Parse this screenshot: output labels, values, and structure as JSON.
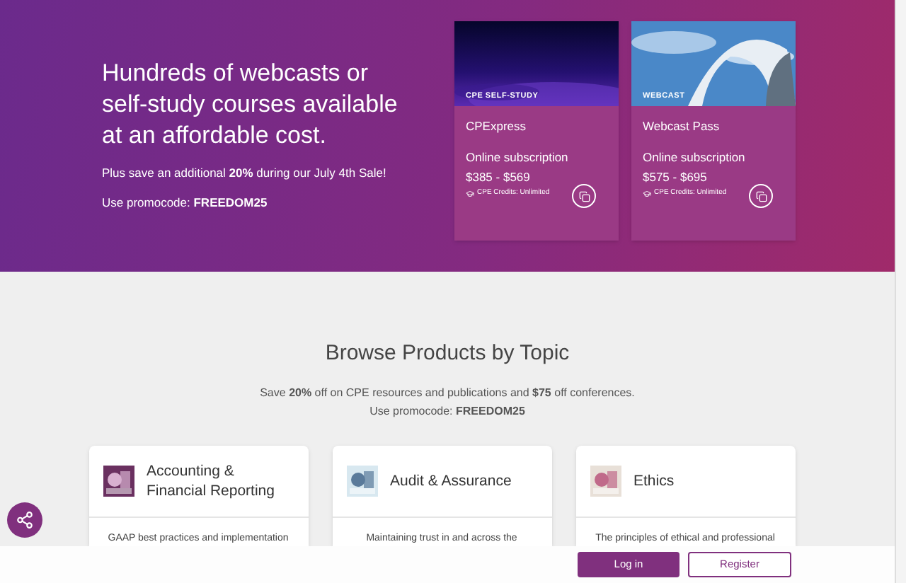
{
  "hero": {
    "heading": "Hundreds of webcasts or self-study courses available at an affordable cost.",
    "sale_text": "Plus save an additional **20%** during our July 4th Sale!",
    "promo_text": "Use promocode: **FREEDOM25**"
  },
  "products": [
    {
      "tag": "CPE SELF-STUDY",
      "name": "CPExpress",
      "subscription": "Online subscription",
      "price": "$385 - $569",
      "credits": "CPE Credits: Unlimited"
    },
    {
      "tag": "WEBCAST",
      "name": "Webcast Pass",
      "subscription": "Online subscription",
      "price": "$575 - $695",
      "credits": "CPE Credits: Unlimited"
    }
  ],
  "browse": {
    "title": "Browse Products by Topic",
    "offer_text": "Save **20%** off on CPE resources and publications and **$75** off conferences.",
    "promo_text": "Use promocode: **FREEDOM25**"
  },
  "topics": [
    {
      "title": "Accounting & Financial Reporting",
      "description": "GAAP best practices and implementation"
    },
    {
      "title": "Audit & Assurance",
      "description": "Maintaining trust in and across the"
    },
    {
      "title": "Ethics",
      "description": "The principles of ethical and professional"
    }
  ],
  "footer_buttons": [
    {
      "label": "Log in",
      "kind": "primary"
    },
    {
      "label": "Register",
      "kind": "outline"
    }
  ]
}
